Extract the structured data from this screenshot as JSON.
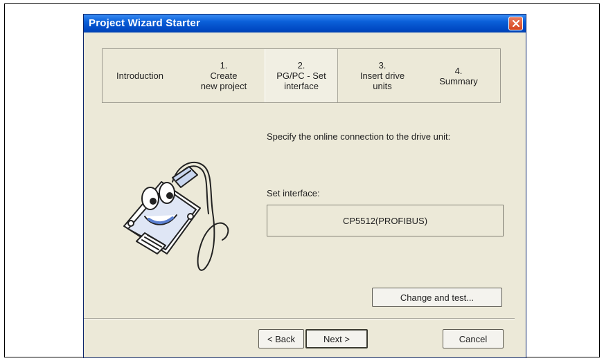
{
  "window": {
    "title": "Project Wizard Starter"
  },
  "steps": [
    {
      "number": "",
      "label_line1": "Introduction",
      "label_line2": ""
    },
    {
      "number": "1.",
      "label_line1": "Create",
      "label_line2": "new project"
    },
    {
      "number": "2.",
      "label_line1": "PG/PC - Set",
      "label_line2": "interface"
    },
    {
      "number": "3.",
      "label_line1": "Insert drive",
      "label_line2": "units"
    },
    {
      "number": "4.",
      "label_line1": "Summary",
      "label_line2": ""
    }
  ],
  "active_step": 2,
  "content": {
    "instruction": "Specify the online connection to the drive unit:",
    "interface_label": "Set interface:",
    "interface_value": "CP5512(PROFIBUS)",
    "change_button": "Change and test..."
  },
  "footer": {
    "back_button": "< Back",
    "next_button": "Next >",
    "cancel_button": "Cancel"
  },
  "colors": {
    "titlebar": "#0a5fd8",
    "close_button": "#d6451f",
    "dialog_bg": "#ece9d8"
  },
  "icons": {
    "close": "close-icon",
    "mascot": "serial-cable-mascot-icon"
  }
}
